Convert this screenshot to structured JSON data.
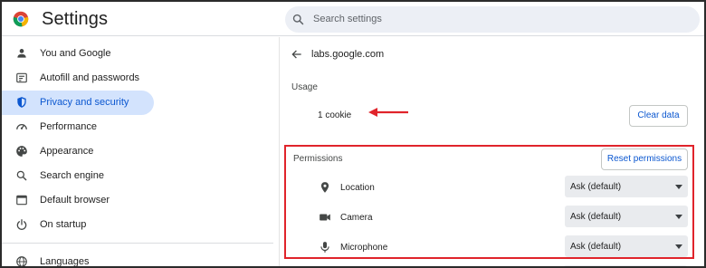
{
  "app": {
    "title": "Settings"
  },
  "search": {
    "placeholder": "Search settings"
  },
  "sidebar": {
    "items": [
      {
        "label": "You and Google",
        "icon": "person-icon"
      },
      {
        "label": "Autofill and passwords",
        "icon": "autofill-icon"
      },
      {
        "label": "Privacy and security",
        "icon": "shield-icon",
        "active": true
      },
      {
        "label": "Performance",
        "icon": "speedometer-icon"
      },
      {
        "label": "Appearance",
        "icon": "palette-icon"
      },
      {
        "label": "Search engine",
        "icon": "search-icon"
      },
      {
        "label": "Default browser",
        "icon": "browser-icon"
      },
      {
        "label": "On startup",
        "icon": "power-icon"
      },
      {
        "label": "Languages",
        "icon": "globe-icon"
      }
    ]
  },
  "site": {
    "name": "labs.google.com"
  },
  "usage": {
    "heading": "Usage",
    "cookies": "1 cookie",
    "clear_label": "Clear data"
  },
  "permissions": {
    "heading": "Permissions",
    "reset_label": "Reset permissions",
    "items": [
      {
        "label": "Location",
        "value": "Ask (default)",
        "icon": "location-pin-icon"
      },
      {
        "label": "Camera",
        "value": "Ask (default)",
        "icon": "videocam-icon"
      },
      {
        "label": "Microphone",
        "value": "Ask (default)",
        "icon": "microphone-icon"
      }
    ]
  },
  "colors": {
    "accent": "#0b57d0",
    "active_bg": "#d3e3fd",
    "highlight": "#e0242b"
  }
}
